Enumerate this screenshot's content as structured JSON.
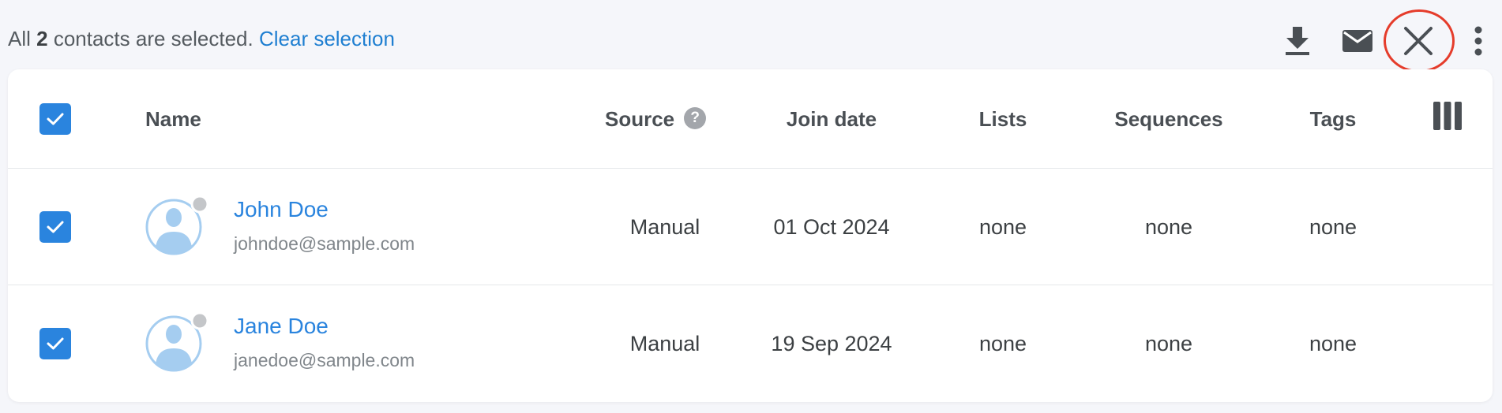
{
  "selection_bar": {
    "prefix": "All ",
    "count": "2",
    "suffix": " contacts are selected.",
    "clear_label": "Clear selection"
  },
  "toolbar_icons": [
    "download-icon",
    "mail-icon",
    "close-icon",
    "more-vertical-icon"
  ],
  "table": {
    "columns": {
      "name": "Name",
      "source": "Source",
      "join_date": "Join date",
      "lists": "Lists",
      "sequences": "Sequences",
      "tags": "Tags"
    },
    "source_help": "?",
    "rows": [
      {
        "name": "John Doe",
        "email": "johndoe@sample.com",
        "source": "Manual",
        "join_date": "01 Oct 2024",
        "lists": "none",
        "sequences": "none",
        "tags": "none"
      },
      {
        "name": "Jane Doe",
        "email": "janedoe@sample.com",
        "source": "Manual",
        "join_date": "19 Sep 2024",
        "lists": "none",
        "sequences": "none",
        "tags": "none"
      }
    ]
  },
  "colors": {
    "accent": "#2a84de",
    "link": "#1f7fd1",
    "highlight_ring": "#e53c2b",
    "avatar_fill": "#a5cdf0",
    "status_dot": "#c4c6c9"
  }
}
